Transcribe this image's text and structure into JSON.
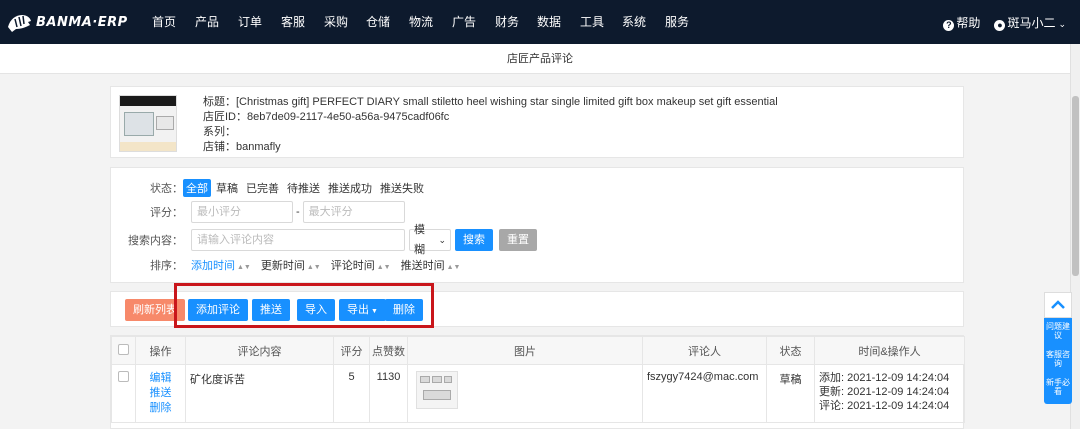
{
  "brand": {
    "name": "BANMA·ERP"
  },
  "nav": {
    "items": [
      "首页",
      "产品",
      "订单",
      "客服",
      "采购",
      "仓储",
      "物流",
      "广告",
      "财务",
      "数据",
      "工具",
      "系统",
      "服务"
    ]
  },
  "header": {
    "help": "帮助",
    "user": "斑马小二"
  },
  "page": {
    "title": "店匠产品评论"
  },
  "product": {
    "title": "标题：[Christmas gift] PERFECT DIARY small stiletto heel wishing star single limited gift box makeup set gift essential",
    "shop_id": "店匠ID：8eb7de09-2117-4e50-a56a-9475cadf06fc",
    "series": "系列：",
    "store": "店铺：banmafly"
  },
  "filters": {
    "status_label": "状态：",
    "status_options": [
      "全部",
      "草稿",
      "已完善",
      "待推送",
      "推送成功",
      "推送失败"
    ],
    "score_label": "评分：",
    "score_min_placeholder": "最小评分",
    "score_max_placeholder": "最大评分",
    "score_sep": "-",
    "search_label": "搜索内容：",
    "search_placeholder": "请输入评论内容",
    "match_mode": "模糊",
    "search_button": "搜索",
    "reset_button": "重置",
    "sort_label": "排序：",
    "sort_options": [
      "添加时间",
      "更新时间",
      "评论时间",
      "推送时间"
    ]
  },
  "actions": {
    "refresh": "刷新列表",
    "add": "添加评论",
    "push": "推送",
    "import": "导入",
    "export": "导出",
    "delete": "删除"
  },
  "table": {
    "headers": [
      "操作",
      "评论内容",
      "评分",
      "点赞数",
      "图片",
      "评论人",
      "状态",
      "时间&操作人"
    ],
    "rows": [
      {
        "ops": [
          "编辑",
          "推送",
          "删除"
        ],
        "content": "矿化度诉苦",
        "score": "5",
        "likes": "1130",
        "reviewer": "fszygy7424@mac.com",
        "status": "草稿",
        "times": [
          "添加: 2021-12-09 14:24:04",
          "更新: 2021-12-09 14:24:04",
          "评论: 2021-12-09 14:24:04"
        ]
      }
    ]
  },
  "side": {
    "items": [
      "问题建议",
      "客服咨询",
      "新手必看"
    ]
  }
}
